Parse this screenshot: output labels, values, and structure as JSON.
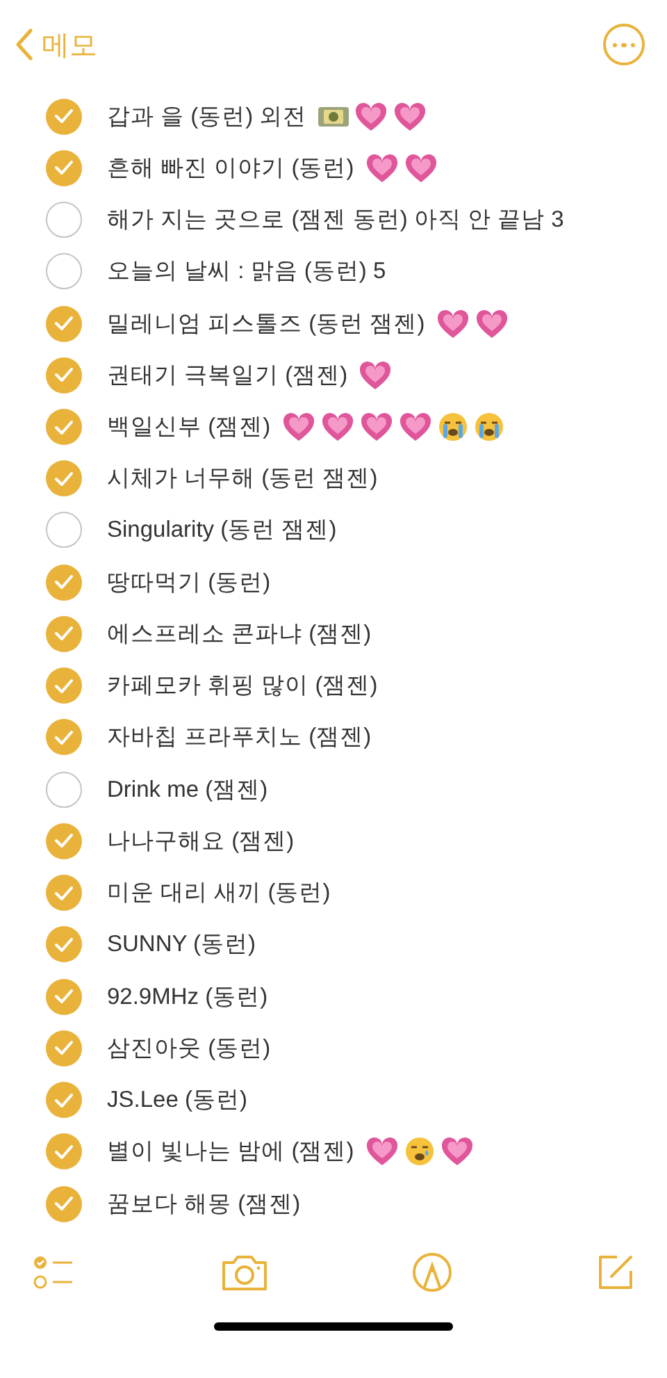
{
  "nav": {
    "back_label": "메모"
  },
  "items": [
    {
      "text": "갑과 을 (동런) 외전",
      "checked": true,
      "emojis": [
        {
          "kind": "money"
        },
        {
          "kind": "heart"
        },
        {
          "kind": "heart"
        }
      ]
    },
    {
      "text": "흔해 빠진 이야기 (동런)",
      "checked": true,
      "emojis": [
        {
          "kind": "heart"
        },
        {
          "kind": "heart"
        }
      ]
    },
    {
      "text": "해가 지는 곳으로 (잼젠 동런) 아직 안 끝남 3",
      "checked": false
    },
    {
      "text": "오늘의 날씨 : 맑음 (동런) 5",
      "checked": false
    },
    {
      "text": "밀레니엄 피스톨즈 (동런 잼젠)",
      "checked": true,
      "emojis": [
        {
          "kind": "heart"
        },
        {
          "kind": "heart"
        }
      ]
    },
    {
      "text": "권태기 극복일기 (잼젠)",
      "checked": true,
      "emojis": [
        {
          "kind": "heart"
        }
      ]
    },
    {
      "text": "백일신부 (잼젠)",
      "checked": true,
      "emojis": [
        {
          "kind": "heart"
        },
        {
          "kind": "heart"
        },
        {
          "kind": "heart"
        },
        {
          "kind": "heart"
        },
        {
          "kind": "sob"
        },
        {
          "kind": "sob"
        }
      ]
    },
    {
      "text": "시체가 너무해 (동런 잼젠)",
      "checked": true
    },
    {
      "text": "Singularity (동런 잼젠)",
      "checked": false
    },
    {
      "text": "땅따먹기 (동런)",
      "checked": true
    },
    {
      "text": "에스프레소 콘파냐 (잼젠)",
      "checked": true
    },
    {
      "text": "카페모카 휘핑 많이 (잼젠)",
      "checked": true
    },
    {
      "text": "자바칩 프라푸치노 (잼젠)",
      "checked": true
    },
    {
      "text": "Drink me (잼젠)",
      "checked": false
    },
    {
      "text": "나나구해요 (잼젠)",
      "checked": true
    },
    {
      "text": "미운 대리 새끼 (동런)",
      "checked": true
    },
    {
      "text": "SUNNY (동런)",
      "checked": true
    },
    {
      "text": "92.9MHz (동런)",
      "checked": true
    },
    {
      "text": "삼진아웃 (동런)",
      "checked": true
    },
    {
      "text": "JS.Lee (동런)",
      "checked": true
    },
    {
      "text": "별이 빛나는 밤에 (잼젠)",
      "checked": true,
      "emojis": [
        {
          "kind": "heart"
        },
        {
          "kind": "cry"
        },
        {
          "kind": "heart"
        }
      ]
    },
    {
      "text": "꿈보다 해몽 (잼젠)",
      "checked": true
    }
  ]
}
